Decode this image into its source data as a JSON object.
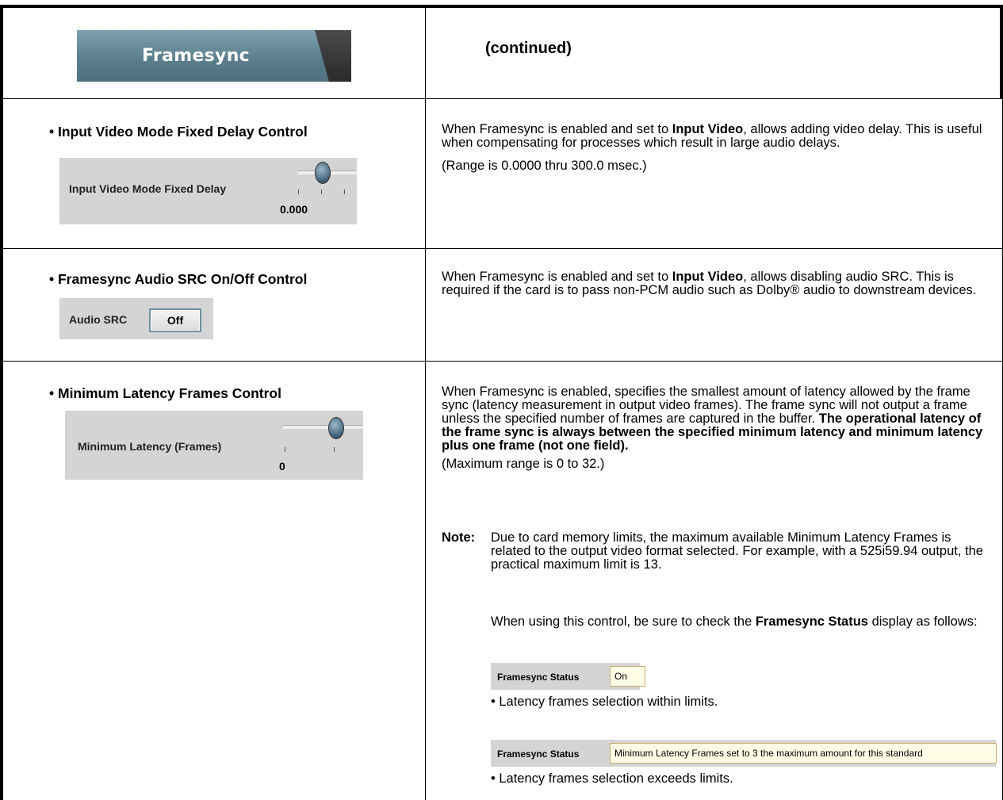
{
  "header": {
    "tab_label": "Framesync",
    "continued": "(continued)"
  },
  "rows": [
    {
      "title": "• Input Video Mode Fixed Delay Control",
      "panel_label": "Input Video Mode Fixed Delay",
      "panel_value": "0.000",
      "desc_pre": "When Framesync is enabled and set to ",
      "desc_bold": "Input Video",
      "desc_post": ", allows adding video delay. This is useful when compensating for processes which result in large audio delays.",
      "desc2": "(Range is 0.0000 thru 300.0 msec.)"
    },
    {
      "title": "• Framesync Audio SRC On/Off Control",
      "panel_label": "Audio SRC",
      "button_label": "Off",
      "desc_pre": "When Framesync is enabled and set to ",
      "desc_bold": "Input Video",
      "desc_post": ", allows disabling audio SRC. This is required if the card is to pass non-PCM audio such as Dolby® audio to downstream devices."
    },
    {
      "title": "• Minimum Latency Frames Control",
      "panel_label": "Minimum Latency (Frames)",
      "panel_value": "0",
      "desc_plain": "When Framesync is enabled, specifies the smallest amount of latency allowed by the frame sync (latency measurement in output video frames). The frame sync will not output a frame unless the specified number of frames are captured in the buffer. ",
      "desc_bold": "The operational latency of the frame sync is always between the specified minimum latency and minimum latency plus one frame (not one field).",
      "desc2": "(Maximum range is 0 to 32.)",
      "note_label": "Note:",
      "note_text": "Due to card memory limits, the maximum available Minimum Latency Frames is related to the output video format selected. For example, with a 525i59.94 output, the practical maximum limit is 13.",
      "note2_pre": "When using this control, be sure to check the ",
      "note2_bold": "Framesync Status",
      "note2_post": " display as follows:",
      "status_label": "Framesync Status",
      "status_ok": "On",
      "status_ok_caption": "• Latency frames selection within limits.",
      "status_err": "Minimum Latency Frames set to 3 the maximum amount for this standard",
      "status_err_caption": "• Latency frames selection exceeds limits."
    }
  ]
}
